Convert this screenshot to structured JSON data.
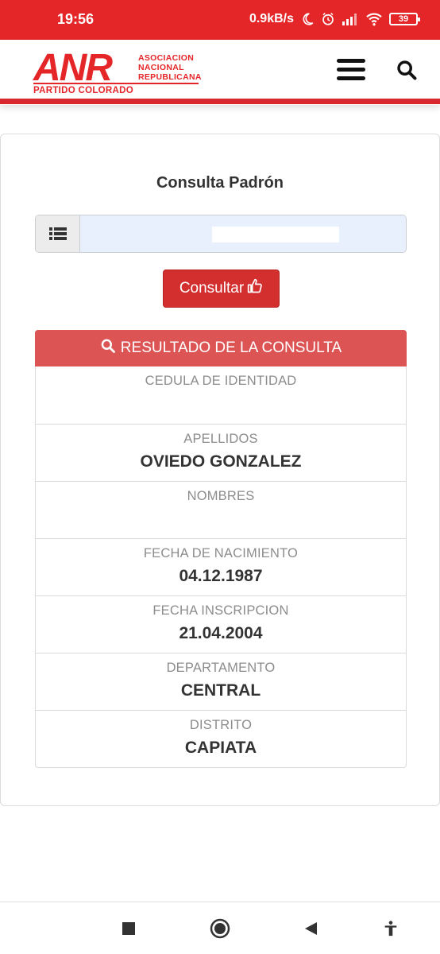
{
  "status_bar": {
    "time": "19:56",
    "net_speed": "0.9kB/s",
    "battery": "39",
    "icons": [
      "moon-icon",
      "alarm-icon",
      "signal-icon",
      "wifi-icon",
      "battery-icon"
    ]
  },
  "header": {
    "logo": {
      "anr": "ANR",
      "line1": "ASOCIACION",
      "line2": "NACIONAL",
      "line3": "REPUBLICANA",
      "partido": "PARTIDO COLORADO"
    },
    "menu_icon": "hamburger-menu-icon",
    "search_icon": "search-icon"
  },
  "colors": {
    "brand_red": "#e52629",
    "button_red": "#d32f2f",
    "result_header_red": "#dd5454",
    "input_blue": "#e8f0fe"
  },
  "main": {
    "title": "Consulta Padrón",
    "input": {
      "value": "",
      "addon_icon": "list-icon"
    },
    "consult_button": {
      "label": "Consultar",
      "icon": "thumbs-up-icon"
    },
    "result_header": {
      "label": "RESULTADO DE LA CONSULTA",
      "icon": "search-icon"
    },
    "rows": [
      {
        "label": "CEDULA DE IDENTIDAD",
        "value": ""
      },
      {
        "label": "APELLIDOS",
        "value": "OVIEDO GONZALEZ"
      },
      {
        "label": "NOMBRES",
        "value": ""
      },
      {
        "label": "FECHA DE NACIMIENTO",
        "value": "04.12.1987"
      },
      {
        "label": "FECHA INSCRIPCION",
        "value": "21.04.2004"
      },
      {
        "label": "DEPARTAMENTO",
        "value": "CENTRAL"
      },
      {
        "label": "DISTRITO",
        "value": "CAPIATA"
      }
    ]
  },
  "nav_bar": {
    "buttons": [
      "recent-apps-icon",
      "home-icon",
      "back-icon",
      "accessibility-icon"
    ]
  }
}
